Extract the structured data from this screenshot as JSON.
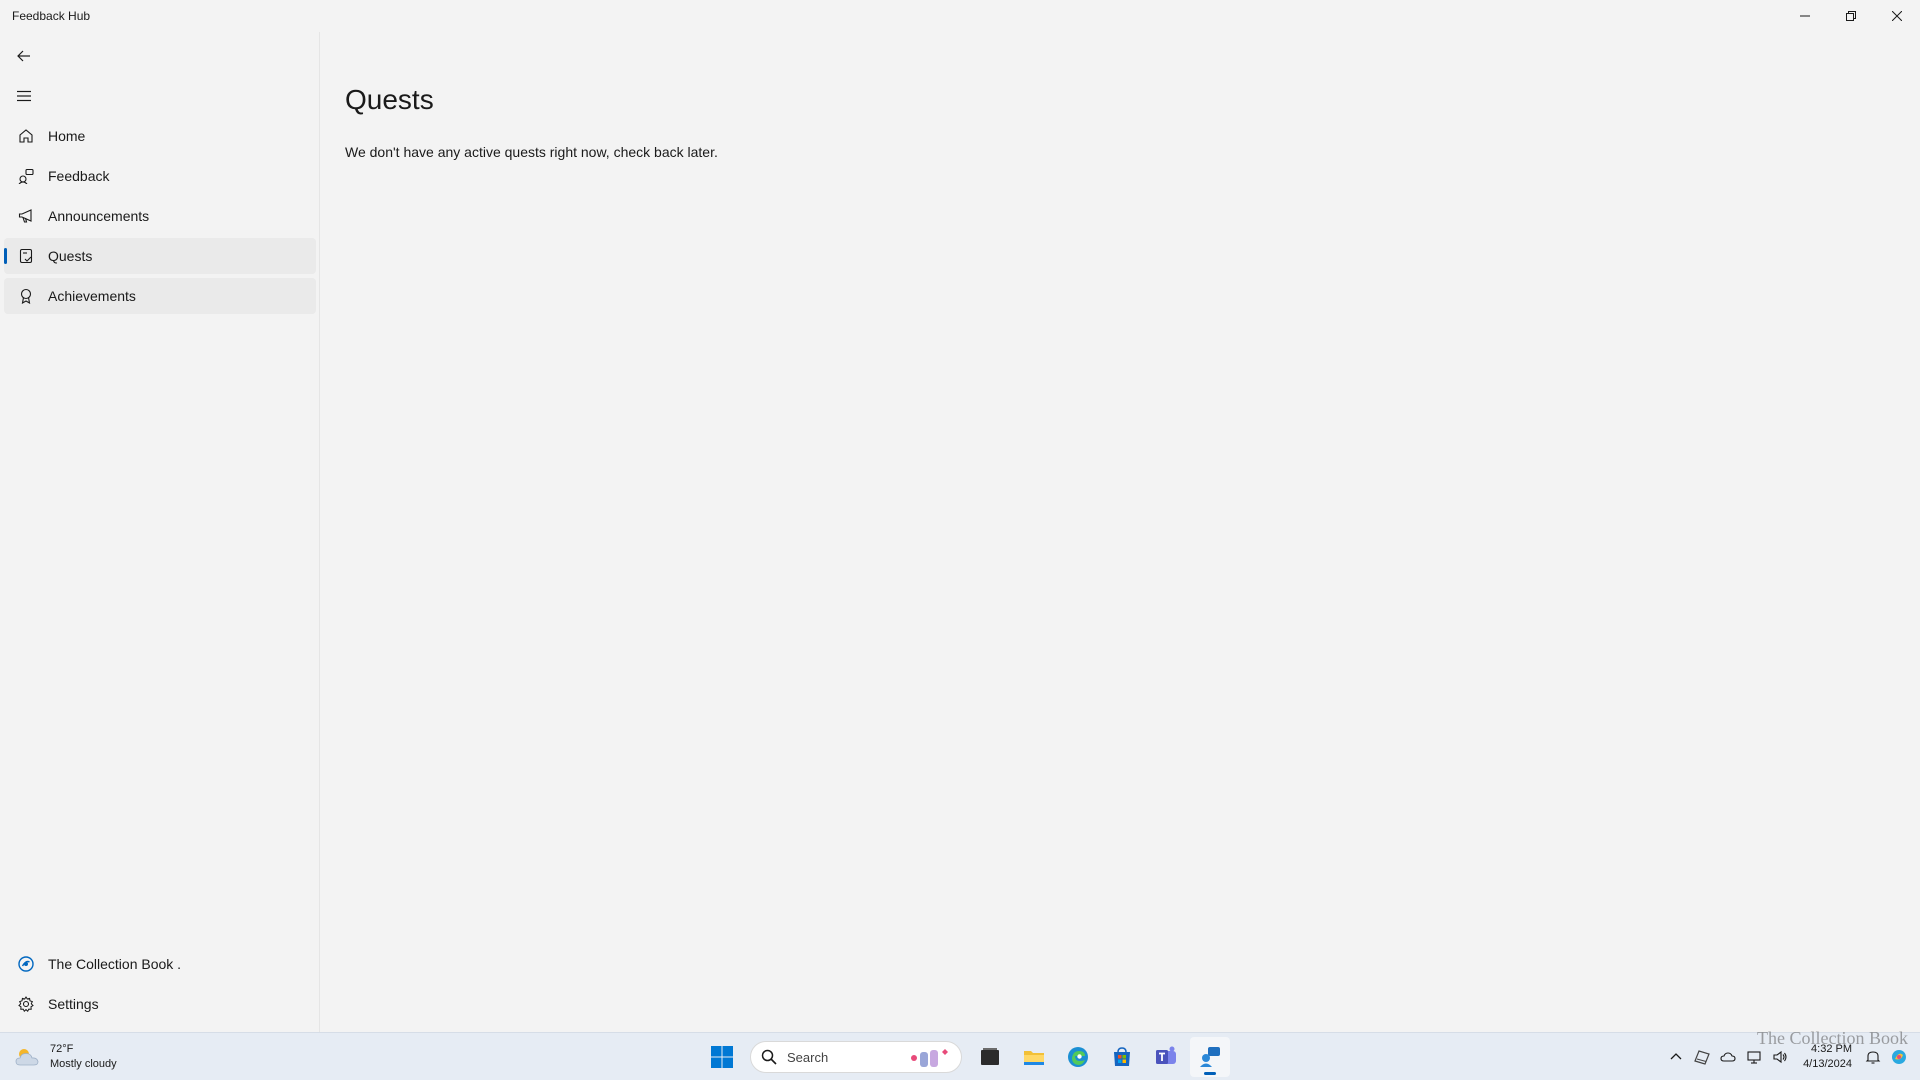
{
  "window": {
    "title": "Feedback Hub"
  },
  "sidebar": {
    "items": [
      {
        "label": "Home",
        "icon": "home-icon"
      },
      {
        "label": "Feedback",
        "icon": "feedback-icon"
      },
      {
        "label": "Announcements",
        "icon": "megaphone-icon"
      },
      {
        "label": "Quests",
        "icon": "quests-icon",
        "selected": true
      },
      {
        "label": "Achievements",
        "icon": "ribbon-icon"
      }
    ],
    "footer": [
      {
        "label": "The Collection Book .",
        "icon": "account-icon"
      },
      {
        "label": "Settings",
        "icon": "gear-icon"
      }
    ]
  },
  "main": {
    "title": "Quests",
    "empty_message": "We don't have any active quests right now, check back later."
  },
  "taskbar": {
    "weather": {
      "temp": "72°F",
      "condition": "Mostly cloudy"
    },
    "search": {
      "label": "Search"
    },
    "clock": {
      "time": "4:32 PM",
      "date": "4/13/2024"
    },
    "watermark": "The Collection Book"
  },
  "colors": {
    "accent": "#005fb8",
    "background": "#f3f3f3",
    "taskbar": "#e6ecf4"
  }
}
